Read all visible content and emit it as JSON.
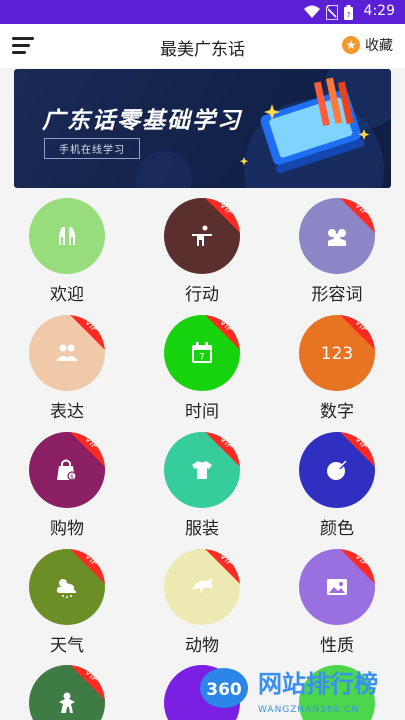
{
  "status": {
    "time": "4:29"
  },
  "header": {
    "title": "最美广东话",
    "favorite_label": "收藏"
  },
  "banner": {
    "title": "广东话零基础学习",
    "subtitle": "手机在线学习"
  },
  "categories": [
    {
      "label": "欢迎",
      "color": "#97dd7b",
      "vip": false,
      "icon": "handshake-icon"
    },
    {
      "label": "行动",
      "color": "#5a2f2e",
      "vip": true,
      "icon": "running-icon"
    },
    {
      "label": "形容词",
      "color": "#8d86c6",
      "vip": true,
      "icon": "people-icon"
    },
    {
      "label": "表达",
      "color": "#f0c9a8",
      "vip": true,
      "icon": "group-icon"
    },
    {
      "label": "时间",
      "color": "#17d30d",
      "vip": true,
      "icon": "calendar-icon"
    },
    {
      "label": "数字",
      "color": "#e87323",
      "vip": true,
      "icon": "numbers-icon"
    },
    {
      "label": "购物",
      "color": "#8a1f63",
      "vip": true,
      "icon": "shopping-bag-icon"
    },
    {
      "label": "服装",
      "color": "#37cc9b",
      "vip": true,
      "icon": "shirt-icon"
    },
    {
      "label": "颜色",
      "color": "#2f2fc2",
      "vip": true,
      "icon": "palette-icon"
    },
    {
      "label": "天气",
      "color": "#6b8f26",
      "vip": true,
      "icon": "weather-icon"
    },
    {
      "label": "动物",
      "color": "#ede9b2",
      "vip": true,
      "icon": "dolphin-icon"
    },
    {
      "label": "性质",
      "color": "#9a6fe0",
      "vip": true,
      "icon": "picture-icon"
    },
    {
      "label": "",
      "color": "#3f7b45",
      "vip": true,
      "icon": "person-icon"
    },
    {
      "label": "",
      "color": "#7b1fe2",
      "vip": false,
      "icon": ""
    },
    {
      "label": "",
      "color": "#4bd64b",
      "vip": false,
      "icon": ""
    }
  ],
  "vip_text": "VIP",
  "watermark": {
    "badge": "360",
    "title": "网站排行榜",
    "url": "WANGZHAN360.CN"
  }
}
